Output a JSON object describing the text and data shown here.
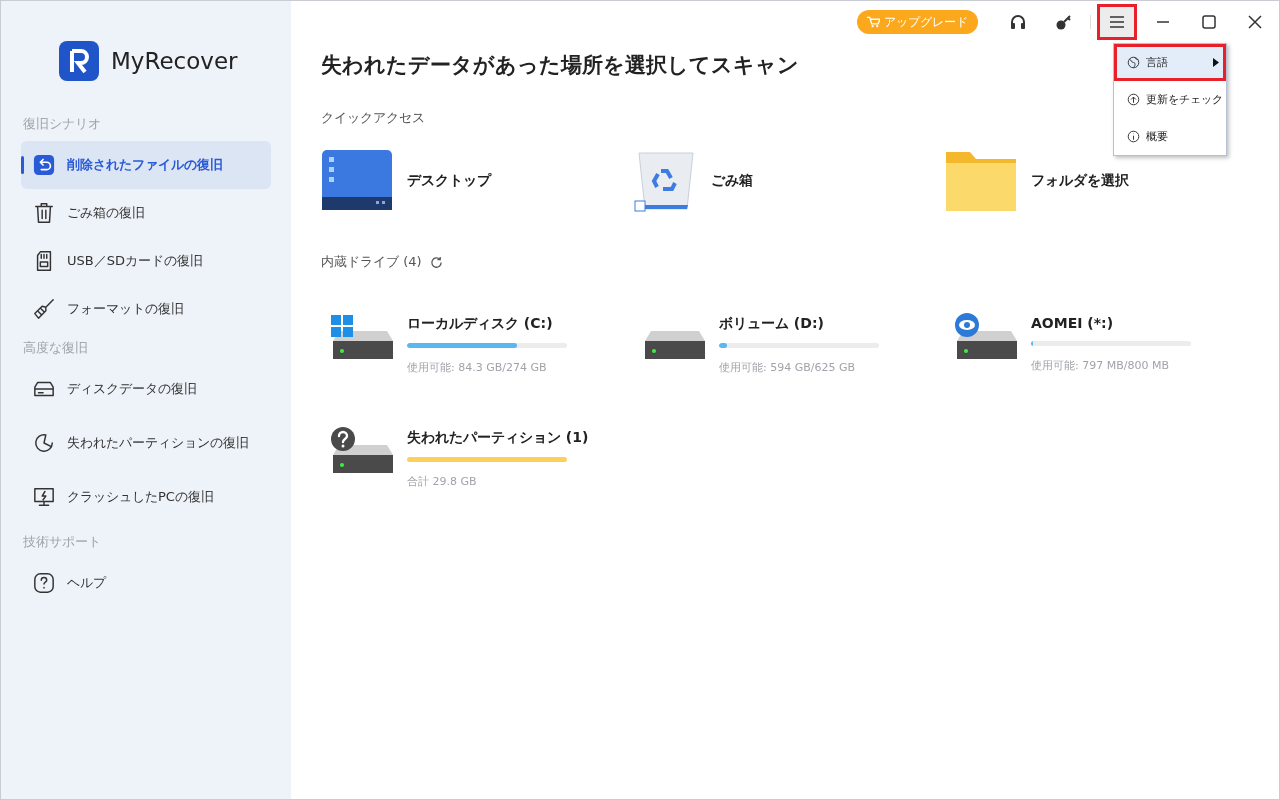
{
  "app": {
    "name": "MyRecover"
  },
  "sidebar": {
    "sections": [
      {
        "title": "復旧シナリオ",
        "items": [
          {
            "label": "削除されたファイルの復旧",
            "kind": "undo",
            "selected": true
          },
          {
            "label": "ごみ箱の復旧",
            "kind": "trash",
            "selected": false
          },
          {
            "label": "USB／SDカードの復旧",
            "kind": "sdcard",
            "selected": false
          },
          {
            "label": "フォーマットの復旧",
            "kind": "broom",
            "selected": false
          }
        ]
      },
      {
        "title": "高度な復旧",
        "items": [
          {
            "label": "ディスクデータの復旧",
            "kind": "disk",
            "selected": false
          },
          {
            "label": "失われたパーティションの復旧",
            "kind": "partition",
            "selected": false
          },
          {
            "label": "クラッシュしたPCの復旧",
            "kind": "monitor",
            "selected": false
          }
        ]
      },
      {
        "title": "技術サポート",
        "items": [
          {
            "label": "ヘルプ",
            "kind": "help",
            "selected": false
          }
        ]
      }
    ]
  },
  "titlebar": {
    "upgrade": "アップグレード",
    "menu_highlighted": true
  },
  "menu": {
    "items": [
      {
        "label": "言語",
        "kind": "globe",
        "submenu": true,
        "highlighted": true
      },
      {
        "label": "更新をチェック",
        "kind": "update",
        "submenu": false,
        "highlighted": false
      },
      {
        "label": "概要",
        "kind": "info",
        "submenu": false,
        "highlighted": false
      }
    ]
  },
  "heading": "失われたデータがあった場所を選択してスキャン",
  "quick_access": {
    "title": "クイックアクセス",
    "items": [
      {
        "label": "デスクトップ",
        "kind": "desktop"
      },
      {
        "label": "ごみ箱",
        "kind": "recycle"
      },
      {
        "label": "フォルダを選択",
        "kind": "folder"
      }
    ]
  },
  "drives": {
    "title": "内蔵ドライブ (4)",
    "items": [
      {
        "name": "ローカルディスク (C:)",
        "kind": "windows",
        "level": 0.69,
        "color": "#5ab8ee",
        "detail": "使用可能: 84.3 GB/274 GB"
      },
      {
        "name": "ボリューム (D:)",
        "kind": "plain",
        "level": 0.05,
        "color": "#5ab8ee",
        "detail": "使用可能: 594 GB/625 GB"
      },
      {
        "name": "AOMEI (*:)",
        "kind": "eye",
        "level": 0.01,
        "color": "#5ab8ee",
        "detail": "使用可能: 797 MB/800 MB"
      },
      {
        "name": "失われたパーティション (1)",
        "kind": "question",
        "level": 1,
        "color": "#fdd059",
        "detail": "合計 29.8 GB"
      }
    ]
  }
}
